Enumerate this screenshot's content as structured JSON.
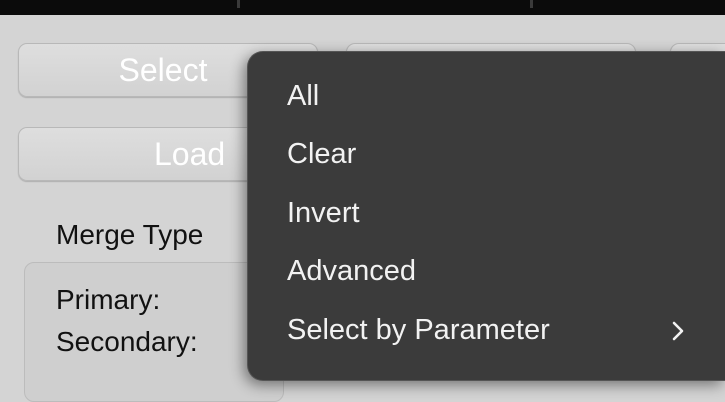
{
  "buttons": {
    "select_label": "Select",
    "load_label": "Load"
  },
  "labels": {
    "merge_type": "Merge Type",
    "primary": "Primary:",
    "secondary": "Secondary:"
  },
  "menu": {
    "items": [
      {
        "label": "All"
      },
      {
        "label": "Clear"
      },
      {
        "label": "Invert"
      },
      {
        "label": "Advanced"
      },
      {
        "label": "Select by Parameter",
        "has_submenu": true
      }
    ]
  },
  "colors": {
    "menu_background": "#3b3b3b",
    "menu_text": "#f2f2f2",
    "button_background": "#d8d8d8",
    "window_background": "#d4d4d4"
  },
  "icons": {
    "submenu": "chevron-right-icon"
  }
}
